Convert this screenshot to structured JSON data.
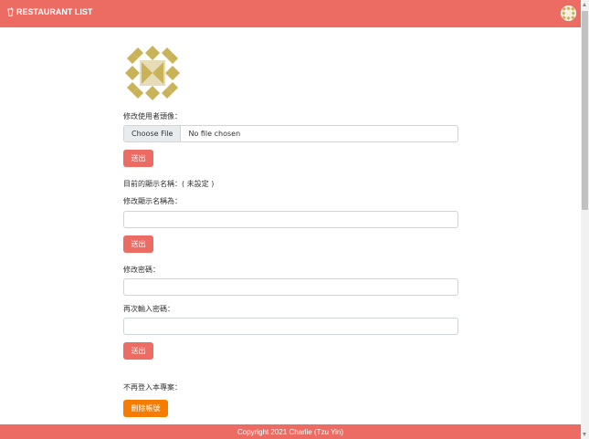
{
  "navbar": {
    "brand": "RESTAURANT LIST"
  },
  "avatar_section": {
    "label": "修改使用者頭像：",
    "choose_file": "Choose File",
    "file_status": "No file chosen",
    "submit": "送出"
  },
  "name_section": {
    "current": "目前的顯示名稱：( 未設定 )",
    "label": "修改顯示名稱為：",
    "value": "",
    "submit": "送出"
  },
  "password_section": {
    "label": "修改密碼：",
    "confirm_label": "再次輸入密碼：",
    "submit": "送出"
  },
  "delete_section": {
    "label": "不再登入本專案：",
    "button": "刪除帳號"
  },
  "footer": {
    "text": "Copyright 2021 Charlie (Tzu Yin)"
  },
  "colors": {
    "primary": "#ec6b63",
    "danger_orange": "#f57c00"
  },
  "icons": {
    "brand": "cup-icon",
    "avatar": "identicon-avatar"
  }
}
